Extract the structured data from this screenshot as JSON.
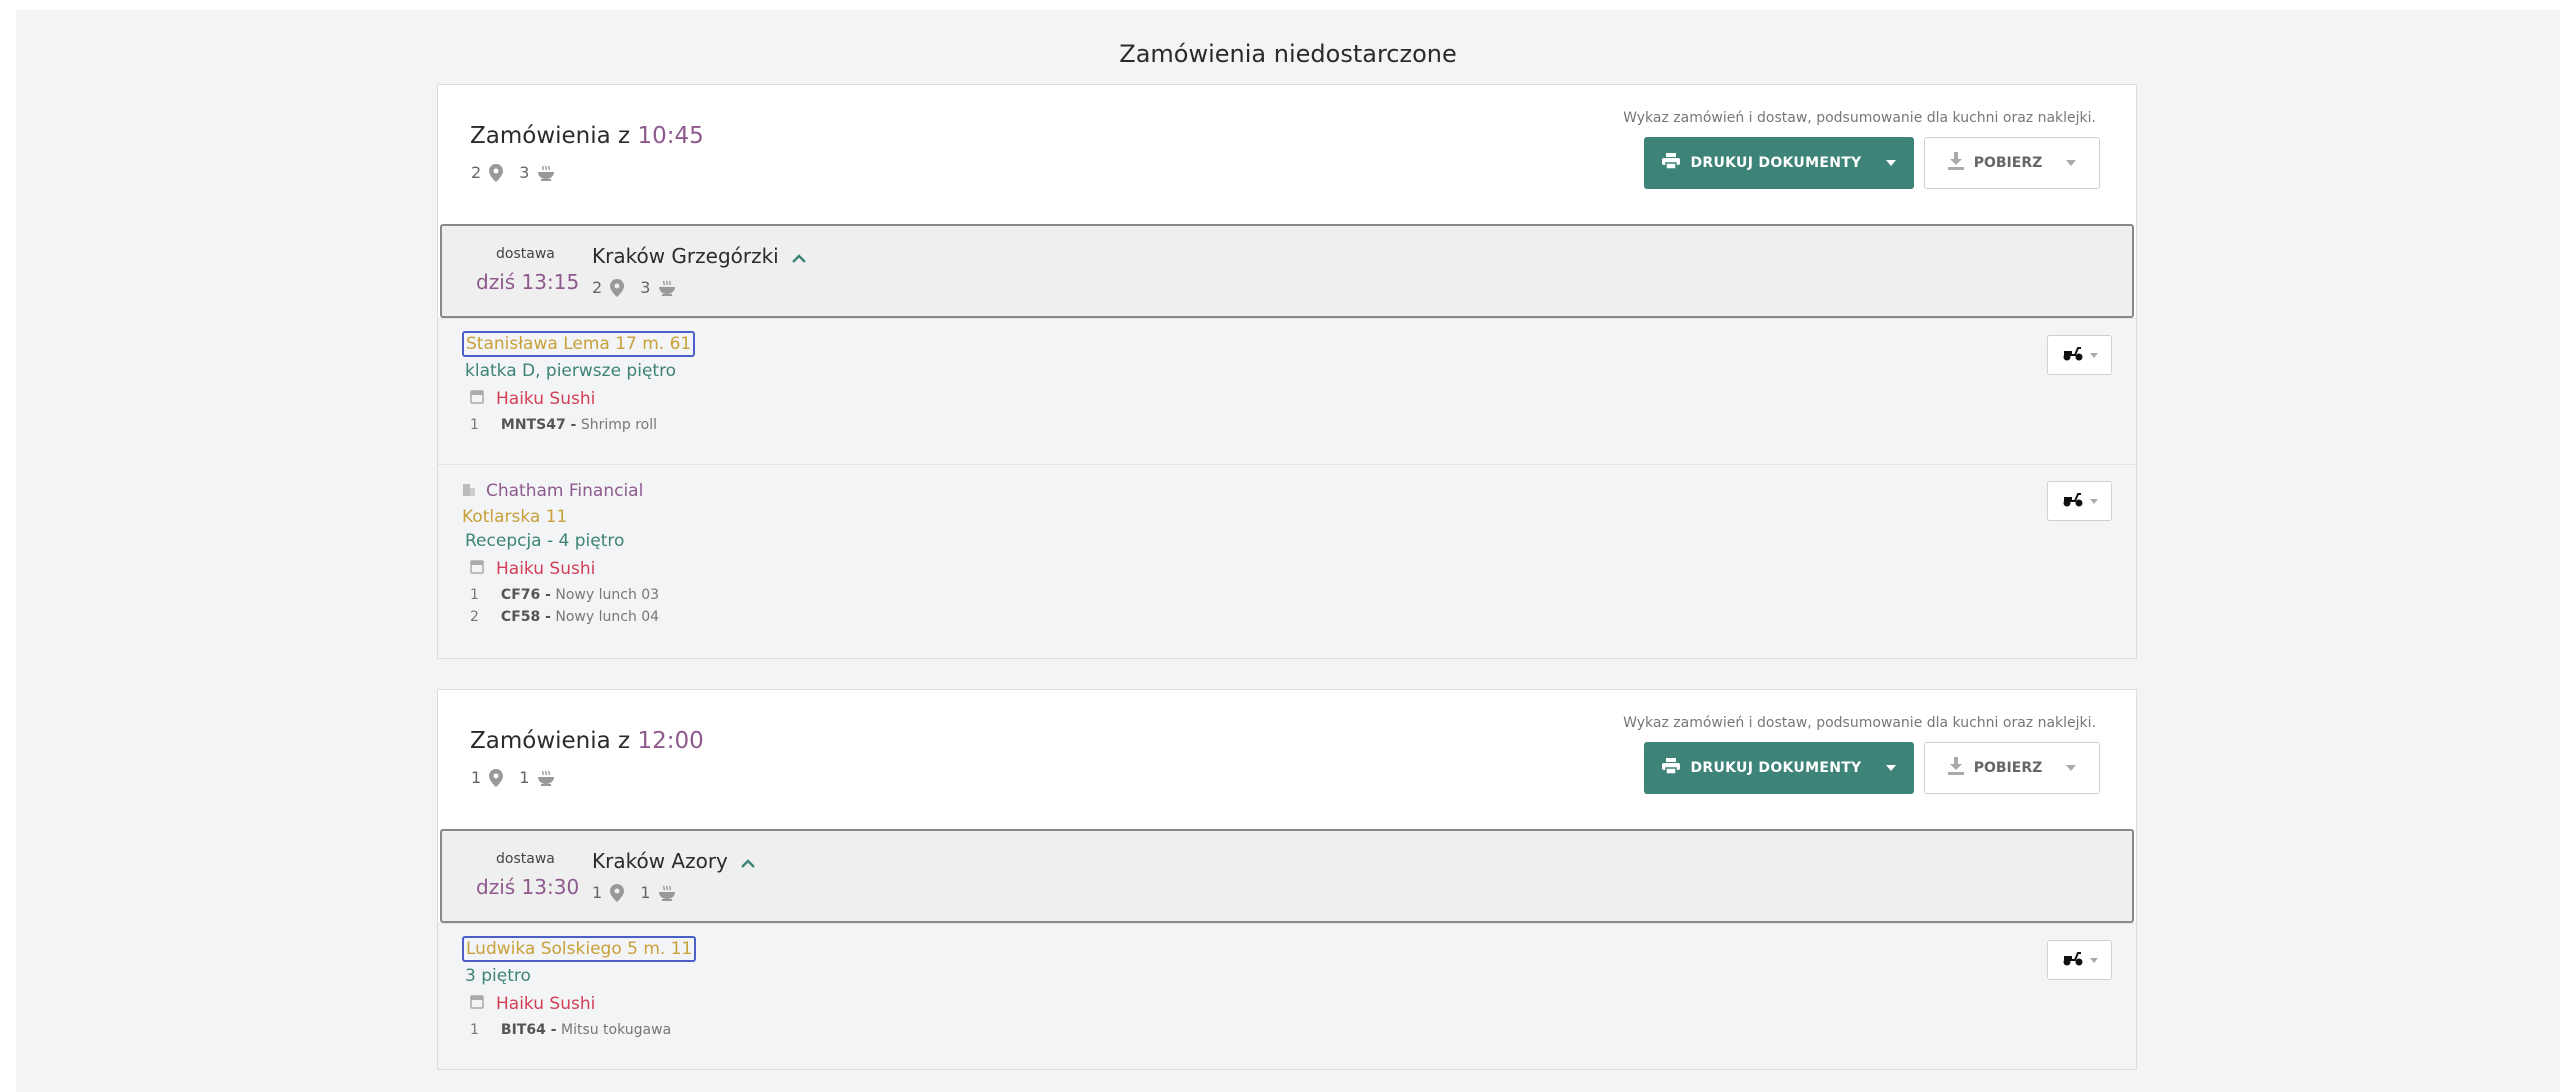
{
  "page": {
    "title": "Zamówienia niedostarczone"
  },
  "batches": [
    {
      "title_prefix": "Zamówienia z",
      "time": "10:45",
      "locations": "2",
      "meals": "3",
      "description": "Wykaz zamówień i dostaw, podsumowanie dla kuchni oraz naklejki.",
      "print_label": "DRUKUJ DOKUMENTY",
      "download_label": "POBIERZ",
      "delivery": {
        "label": "dostawa",
        "time": "dziś 13:15",
        "city": "Kraków Grzegórzki",
        "locations": "2",
        "meals": "3"
      },
      "orders": [
        {
          "address": "Stanisława Lema 17 m. 61",
          "note": "klatka D, pierwsze piętro",
          "restaurant": "Haiku Sushi",
          "items": [
            {
              "qty": "1",
              "code": "MNTS47 -",
              "name": "Shrimp roll"
            }
          ]
        },
        {
          "company": "Chatham Financial",
          "address": "Kotlarska 11",
          "note": "Recepcja - 4 piętro",
          "restaurant": "Haiku Sushi",
          "items": [
            {
              "qty": "1",
              "code": "CF76 -",
              "name": "Nowy lunch 03"
            },
            {
              "qty": "2",
              "code": "CF58 -",
              "name": "Nowy lunch 04"
            }
          ]
        }
      ]
    },
    {
      "title_prefix": "Zamówienia z",
      "time": "12:00",
      "locations": "1",
      "meals": "1",
      "description": "Wykaz zamówień i dostaw, podsumowanie dla kuchni oraz naklejki.",
      "print_label": "DRUKUJ DOKUMENTY",
      "download_label": "POBIERZ",
      "delivery": {
        "label": "dostawa",
        "time": "dziś 13:30",
        "city": "Kraków Azory",
        "locations": "1",
        "meals": "1"
      },
      "orders": [
        {
          "address": "Ludwika Solskiego 5 m. 11",
          "note": "3 piętro",
          "restaurant": "Haiku Sushi",
          "items": [
            {
              "qty": "1",
              "code": "BIT64 -",
              "name": "Mitsu tokugawa"
            }
          ]
        }
      ]
    }
  ],
  "icons": {
    "location": "map-pin-icon",
    "meal": "meal-bowl-icon",
    "print": "printer-icon",
    "download": "download-icon",
    "collapse": "chevron-up-icon",
    "restaurant": "store-icon",
    "company": "building-icon",
    "courier": "scooter-icon"
  },
  "colors": {
    "accent": "#3d8378",
    "time": "#8e5a8e",
    "address": "#c9a03a",
    "restaurant": "#d23f57"
  }
}
